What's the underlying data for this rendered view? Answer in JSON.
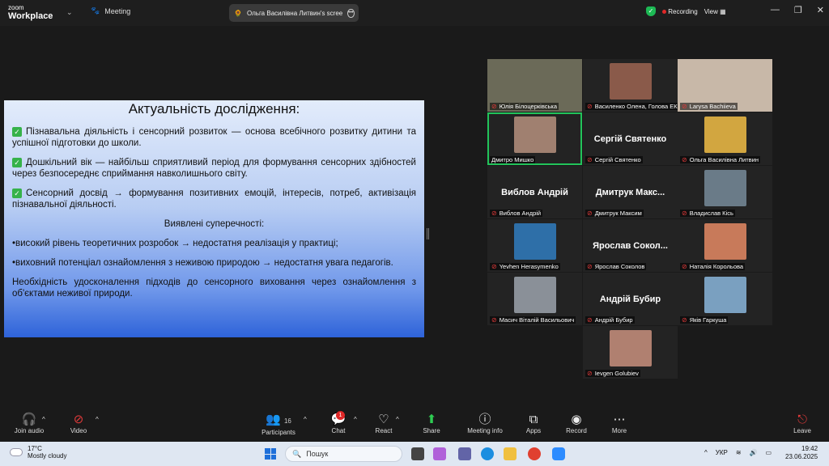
{
  "app": {
    "logo_small": "zoom",
    "logo_big": "Workplace",
    "meeting_label": "Meeting"
  },
  "share_tab": {
    "title": "Ольга Василівна Литвин's scree"
  },
  "status": {
    "recording": "Recording",
    "view": "View"
  },
  "slide": {
    "title": "Актуальність дослідження:",
    "points": [
      "Пізнавальна діяльність і сенсорний розвиток — основа всебічного розвитку дитини та успішної підготовки до школи.",
      "Дошкільний вік — найбільш сприятливий період для формування сенсорних здібностей через безпосереднє сприймання навколишнього світу.",
      "Сенсорний досвід → формування позитивних емоцій, інтересів, потреб, активізація пізнавальної діяльності."
    ],
    "contradictions_title": "Виявлені суперечності:",
    "contradictions": [
      "•високий рівень теоретичних розробок → недостатня реалізація у практиці;",
      "•виховний потенціал ознайомлення з неживою природою → недостатня увага педагогів."
    ],
    "conclusion": "Необхідність удосконалення підходів до сенсорного виховання через ознайомлення з об'єктами неживої природи."
  },
  "participants": [
    {
      "name": "Юлія Білоцерківська",
      "big": "",
      "color": "#6b6a58"
    },
    {
      "name": "Василенко Олена, Голова ЕК",
      "big": "",
      "color": "#8a5a4a"
    },
    {
      "name": "Larysa Bachiieva",
      "big": "",
      "color": "#c8b8a8"
    },
    {
      "name": "Дмитро Мишко",
      "big": "",
      "color": "#a08070"
    },
    {
      "name": "Сергій Святенко",
      "big": "Сергій Святенко",
      "color": ""
    },
    {
      "name": "Ольга Василівна Литвин",
      "big": "",
      "color": "#d2a640"
    },
    {
      "name": "Виблов Андрій",
      "big": "Виблов Андрій",
      "color": ""
    },
    {
      "name": "Дмитрук Максим",
      "big": "Дмитрук Макс...",
      "color": ""
    },
    {
      "name": "Владислав Кісь",
      "big": "",
      "color": "#6a7b88"
    },
    {
      "name": "Yevhen Herasymenko",
      "big": "",
      "color": "#2e6fa8"
    },
    {
      "name": "Ярослав Соколов",
      "big": "Ярослав Сокол...",
      "color": ""
    },
    {
      "name": "Наталія Корольова",
      "big": "",
      "color": "#c87a5a"
    },
    {
      "name": "Масич Віталій Васильович",
      "big": "",
      "color": "#8a9098"
    },
    {
      "name": "Андрій Бубир",
      "big": "Андрій Бубир",
      "color": ""
    },
    {
      "name": "Яків Гаркуша",
      "big": "",
      "color": "#7aa0c0"
    },
    {
      "name": "Ievgen Golubiev",
      "big": "",
      "color": "#b08070"
    }
  ],
  "toolbar": {
    "join_audio": "Join audio",
    "video": "Video",
    "participants": "Participants",
    "participants_count": "16",
    "chat": "Chat",
    "chat_badge": "1",
    "react": "React",
    "share": "Share",
    "meeting_info": "Meeting info",
    "apps": "Apps",
    "record": "Record",
    "more": "More",
    "leave": "Leave"
  },
  "taskbar": {
    "temp": "17°C",
    "weather": "Mostly cloudy",
    "search_placeholder": "Пошук",
    "lang": "УКР",
    "time": "19:42",
    "date": "23.06.2025"
  }
}
